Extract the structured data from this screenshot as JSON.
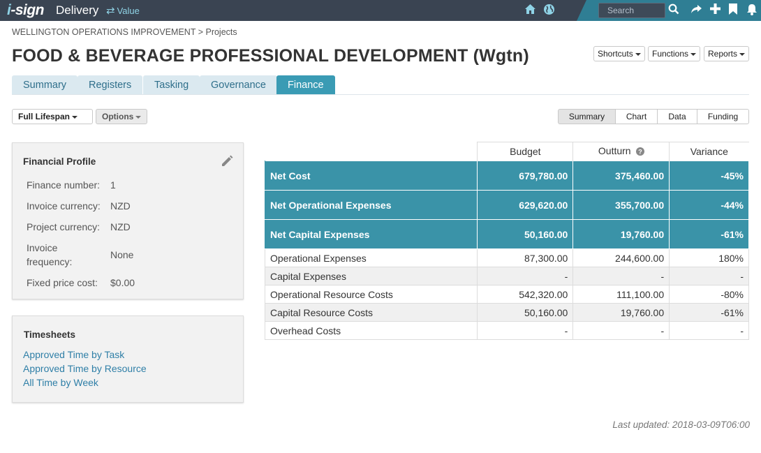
{
  "topbar": {
    "logo_prefix": "i",
    "logo_rest": "-sign",
    "app_title": "Delivery",
    "value_link": "Value",
    "search_placeholder": "Search",
    "icons": [
      "home-icon",
      "globe-icon",
      "search-icon",
      "share-icon",
      "plus-icon",
      "bookmark-icon",
      "bell-icon"
    ]
  },
  "breadcrumb": "WELLINGTON OPERATIONS IMPROVEMENT > Projects",
  "page_title": "FOOD & BEVERAGE PROFESSIONAL DEVELOPMENT (Wgtn)",
  "header_buttons": [
    "Shortcuts",
    "Functions",
    "Reports"
  ],
  "tabs": [
    {
      "label": "Summary",
      "active": false
    },
    {
      "label": "Registers",
      "active": false
    },
    {
      "label": "Tasking",
      "active": false
    },
    {
      "label": "Governance",
      "active": false
    },
    {
      "label": "Finance",
      "active": true
    }
  ],
  "toolbar": {
    "lifespan": "Full Lifespan",
    "options": "Options",
    "views": [
      "Summary",
      "Chart",
      "Data",
      "Funding"
    ],
    "active_view": "Summary"
  },
  "financial_profile": {
    "title": "Financial Profile",
    "rows": [
      {
        "label": "Finance number:",
        "value": "1"
      },
      {
        "label": "Invoice currency:",
        "value": "NZD"
      },
      {
        "label": "Project currency:",
        "value": "NZD"
      },
      {
        "label": "Invoice frequency:",
        "value": "None"
      },
      {
        "label": "Fixed price cost:",
        "value": "$0.00"
      }
    ]
  },
  "timesheets": {
    "title": "Timesheets",
    "links": [
      "Approved Time by Task",
      "Approved Time by Resource",
      "All Time by Week"
    ]
  },
  "finance_table": {
    "columns": [
      "Budget",
      "Outturn",
      "Variance"
    ],
    "summary_rows": [
      {
        "label": "Net Cost",
        "budget": "679,780.00",
        "outturn": "375,460.00",
        "variance": "-45%"
      },
      {
        "label": "Net Operational Expenses",
        "budget": "629,620.00",
        "outturn": "355,700.00",
        "variance": "-44%"
      },
      {
        "label": "Net Capital Expenses",
        "budget": "50,160.00",
        "outturn": "19,760.00",
        "variance": "-61%"
      }
    ],
    "detail_rows": [
      {
        "label": "Operational Expenses",
        "budget": "87,300.00",
        "outturn": "244,600.00",
        "variance": "180%"
      },
      {
        "label": "Capital Expenses",
        "budget": "-",
        "outturn": "-",
        "variance": "-"
      },
      {
        "label": "Operational Resource Costs",
        "budget": "542,320.00",
        "outturn": "111,100.00",
        "variance": "-80%"
      },
      {
        "label": "Capital Resource Costs",
        "budget": "50,160.00",
        "outturn": "19,760.00",
        "variance": "-61%"
      },
      {
        "label": "Overhead Costs",
        "budget": "-",
        "outturn": "-",
        "variance": "-"
      }
    ]
  },
  "last_updated": "Last updated: 2018-03-09T06:00"
}
